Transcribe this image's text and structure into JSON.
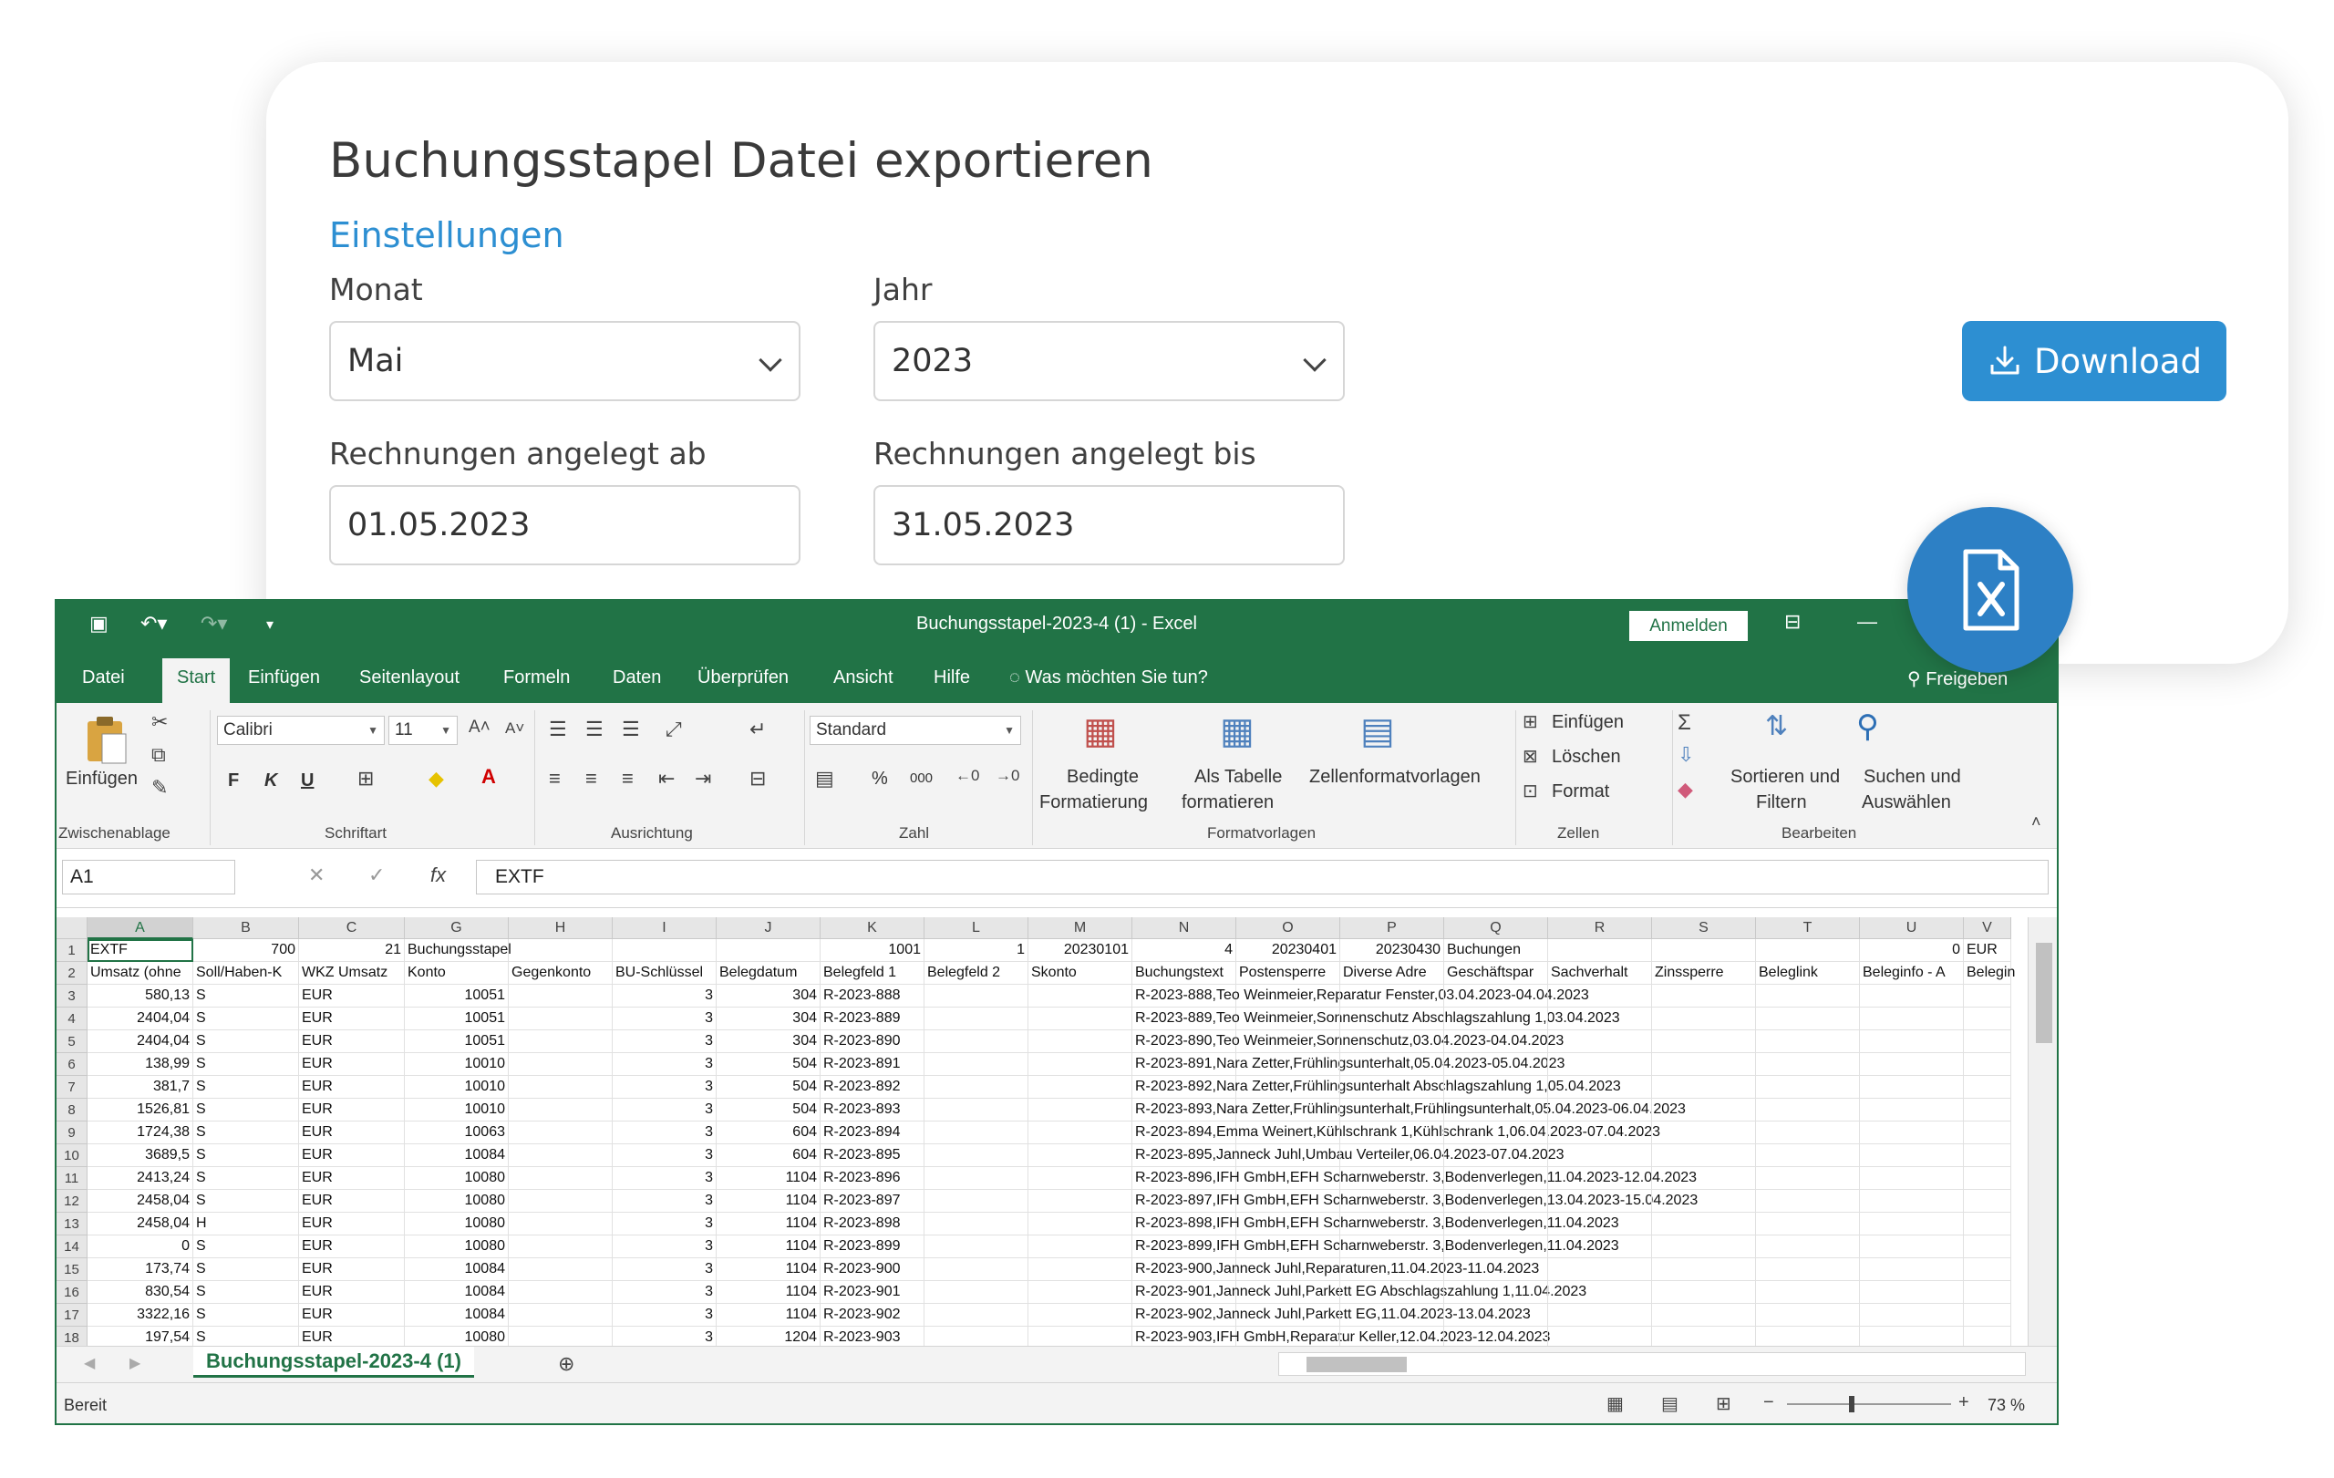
{
  "card": {
    "title": "Buchungsstapel Datei exportieren",
    "subtitle": "Einstellungen",
    "fields": {
      "month": {
        "label": "Monat",
        "value": "Mai"
      },
      "year": {
        "label": "Jahr",
        "value": "2023"
      },
      "from": {
        "label": "Rechnungen angelegt ab",
        "value": "01.05.2023"
      },
      "to": {
        "label": "Rechnungen angelegt bis",
        "value": "31.05.2023"
      }
    },
    "download_label": "Download",
    "accent_color": "#2d8fd2"
  },
  "excel": {
    "title": "Buchungsstapel-2023-4 (1)  -  Excel",
    "signin_label": "Anmelden",
    "share_label": "Freigeben",
    "tabs": [
      "Datei",
      "Start",
      "Einfügen",
      "Seitenlayout",
      "Formeln",
      "Daten",
      "Überprüfen",
      "Ansicht",
      "Hilfe"
    ],
    "active_tab": "Start",
    "tell_me": "Was möchten Sie tun?",
    "ribbon": {
      "paste": "Einfügen",
      "font_name": "Calibri",
      "font_size": "11",
      "bold": "F",
      "italic": "K",
      "underline": "U",
      "number_format": "Standard",
      "percent": "%",
      "thousands": "000",
      "cond_format_1": "Bedingte",
      "cond_format_2": "Formatierung",
      "as_table_1": "Als Tabelle",
      "as_table_2": "formatieren",
      "cell_styles": "Zellenformatvorlagen",
      "insert": "Einfügen",
      "delete": "Löschen",
      "format": "Format",
      "sort_1": "Sortieren und",
      "sort_2": "Filtern",
      "find_1": "Suchen und",
      "find_2": "Auswählen",
      "group_clipboard": "Zwischenablage",
      "group_font": "Schriftart",
      "group_align": "Ausrichtung",
      "group_number": "Zahl",
      "group_styles": "Formatvorlagen",
      "group_cells": "Zellen",
      "group_edit": "Bearbeiten"
    },
    "namebox": "A1",
    "formula": "EXTF",
    "columns": [
      "A",
      "B",
      "C",
      "G",
      "H",
      "I",
      "J",
      "K",
      "L",
      "M",
      "N",
      "O",
      "P",
      "Q",
      "R",
      "S",
      "T",
      "U",
      "V"
    ],
    "rows": [
      [
        "1",
        [
          "EXTF",
          "700",
          "21",
          "Buchungsstapel",
          "",
          "",
          "",
          "1001",
          "1",
          "20230101",
          "4",
          "20230401",
          "20230430",
          "Buchungen",
          "",
          "",
          "",
          "0",
          "EUR"
        ]
      ],
      [
        "2",
        [
          "Umsatz (ohne",
          "Soll/Haben-K",
          "WKZ Umsatz",
          "Konto",
          "Gegenkonto",
          "BU-Schlüssel",
          "Belegdatum",
          "Belegfeld 1",
          "Belegfeld 2",
          "Skonto",
          "Buchungstext",
          "Postensperre",
          "Diverse Adre",
          "Geschäftspar",
          "Sachverhalt",
          "Zinssperre",
          "Beleglink",
          "Beleginfo - A",
          "Belegin"
        ]
      ],
      [
        "3",
        [
          "580,13",
          "S",
          "EUR",
          "10051",
          "",
          "3",
          "304",
          "R-2023-888",
          "",
          "",
          "R-2023-888,Teo Weinmeier,Reparatur Fenster,03.04.2023-04.04.2023",
          "",
          "",
          "",
          "",
          "",
          "",
          "",
          ""
        ]
      ],
      [
        "4",
        [
          "2404,04",
          "S",
          "EUR",
          "10051",
          "",
          "3",
          "304",
          "R-2023-889",
          "",
          "",
          "R-2023-889,Teo Weinmeier,Sonnenschutz Abschlagszahlung 1,03.04.2023",
          "",
          "",
          "",
          "",
          "",
          "",
          "",
          ""
        ]
      ],
      [
        "5",
        [
          "2404,04",
          "S",
          "EUR",
          "10051",
          "",
          "3",
          "304",
          "R-2023-890",
          "",
          "",
          "R-2023-890,Teo Weinmeier,Sonnenschutz,03.04.2023-04.04.2023",
          "",
          "",
          "",
          "",
          "",
          "",
          "",
          ""
        ]
      ],
      [
        "6",
        [
          "138,99",
          "S",
          "EUR",
          "10010",
          "",
          "3",
          "504",
          "R-2023-891",
          "",
          "",
          "R-2023-891,Nara Zetter,Frühlingsunterhalt,05.04.2023-05.04.2023",
          "",
          "",
          "",
          "",
          "",
          "",
          "",
          ""
        ]
      ],
      [
        "7",
        [
          "381,7",
          "S",
          "EUR",
          "10010",
          "",
          "3",
          "504",
          "R-2023-892",
          "",
          "",
          "R-2023-892,Nara Zetter,Frühlingsunterhalt Abschlagszahlung 1,05.04.2023",
          "",
          "",
          "",
          "",
          "",
          "",
          "",
          ""
        ]
      ],
      [
        "8",
        [
          "1526,81",
          "S",
          "EUR",
          "10010",
          "",
          "3",
          "504",
          "R-2023-893",
          "",
          "",
          "R-2023-893,Nara Zetter,Frühlingsunterhalt,Frühlingsunterhalt,05.04.2023-06.04.2023",
          "",
          "",
          "",
          "",
          "",
          "",
          "",
          ""
        ]
      ],
      [
        "9",
        [
          "1724,38",
          "S",
          "EUR",
          "10063",
          "",
          "3",
          "604",
          "R-2023-894",
          "",
          "",
          "R-2023-894,Emma Weinert,Kühlschrank 1,Kühlschrank 1,06.04.2023-07.04.2023",
          "",
          "",
          "",
          "",
          "",
          "",
          "",
          ""
        ]
      ],
      [
        "10",
        [
          "3689,5",
          "S",
          "EUR",
          "10084",
          "",
          "3",
          "604",
          "R-2023-895",
          "",
          "",
          "R-2023-895,Janneck Juhl,Umbau Verteiler,06.04.2023-07.04.2023",
          "",
          "",
          "",
          "",
          "",
          "",
          "",
          ""
        ]
      ],
      [
        "11",
        [
          "2413,24",
          "S",
          "EUR",
          "10080",
          "",
          "3",
          "1104",
          "R-2023-896",
          "",
          "",
          "R-2023-896,IFH GmbH,EFH Scharnweberstr. 3,Bodenverlegen,11.04.2023-12.04.2023",
          "",
          "",
          "",
          "",
          "",
          "",
          "",
          ""
        ]
      ],
      [
        "12",
        [
          "2458,04",
          "S",
          "EUR",
          "10080",
          "",
          "3",
          "1104",
          "R-2023-897",
          "",
          "",
          "R-2023-897,IFH GmbH,EFH Scharnweberstr. 3,Bodenverlegen,13.04.2023-15.04.2023",
          "",
          "",
          "",
          "",
          "",
          "",
          "",
          ""
        ]
      ],
      [
        "13",
        [
          "2458,04",
          "H",
          "EUR",
          "10080",
          "",
          "3",
          "1104",
          "R-2023-898",
          "",
          "",
          "R-2023-898,IFH GmbH,EFH Scharnweberstr. 3,Bodenverlegen,11.04.2023",
          "",
          "",
          "",
          "",
          "",
          "",
          "",
          ""
        ]
      ],
      [
        "14",
        [
          "0",
          "S",
          "EUR",
          "10080",
          "",
          "3",
          "1104",
          "R-2023-899",
          "",
          "",
          "R-2023-899,IFH GmbH,EFH Scharnweberstr. 3,Bodenverlegen,11.04.2023",
          "",
          "",
          "",
          "",
          "",
          "",
          "",
          ""
        ]
      ],
      [
        "15",
        [
          "173,74",
          "S",
          "EUR",
          "10084",
          "",
          "3",
          "1104",
          "R-2023-900",
          "",
          "",
          "R-2023-900,Janneck Juhl,Reparaturen,11.04.2023-11.04.2023",
          "",
          "",
          "",
          "",
          "",
          "",
          "",
          ""
        ]
      ],
      [
        "16",
        [
          "830,54",
          "S",
          "EUR",
          "10084",
          "",
          "3",
          "1104",
          "R-2023-901",
          "",
          "",
          "R-2023-901,Janneck Juhl,Parkett EG Abschlagszahlung 1,11.04.2023",
          "",
          "",
          "",
          "",
          "",
          "",
          "",
          ""
        ]
      ],
      [
        "17",
        [
          "3322,16",
          "S",
          "EUR",
          "10084",
          "",
          "3",
          "1104",
          "R-2023-902",
          "",
          "",
          "R-2023-902,Janneck Juhl,Parkett EG,11.04.2023-13.04.2023",
          "",
          "",
          "",
          "",
          "",
          "",
          "",
          ""
        ]
      ],
      [
        "18",
        [
          "197,54",
          "S",
          "EUR",
          "10080",
          "",
          "3",
          "1204",
          "R-2023-903",
          "",
          "",
          "R-2023-903,IFH GmbH,Reparatur Keller,12.04.2023-12.04.2023",
          "",
          "",
          "",
          "",
          "",
          "",
          "",
          ""
        ]
      ]
    ],
    "sheet_tab": "Buchungsstapel-2023-4 (1)",
    "status": "Bereit",
    "zoom": "73 %",
    "brand_color": "#217346"
  }
}
